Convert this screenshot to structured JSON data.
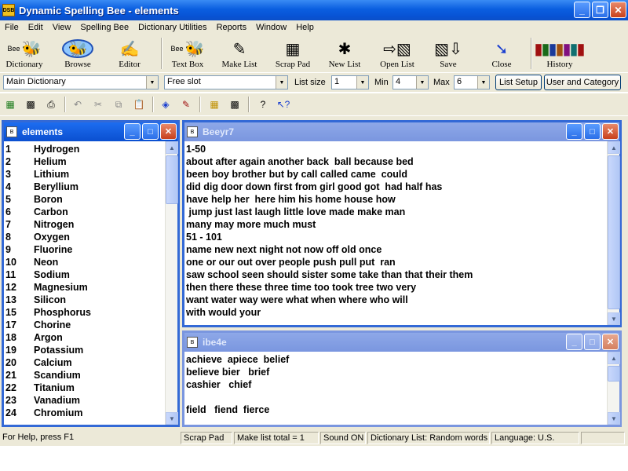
{
  "window": {
    "title": "Dynamic Spelling Bee - elements",
    "app_icon_text": "DSB"
  },
  "menu": [
    "File",
    "Edit",
    "View",
    "Spelling Bee",
    "Dictionary Utilities",
    "Reports",
    "Window",
    "Help"
  ],
  "toolbar": {
    "dictionary": "Dictionary",
    "dictionary_icon_text": "Bee",
    "browse": "Browse",
    "editor": "Editor",
    "textbox": "Text Box",
    "textbox_icon_text": "Bee",
    "makelist": "Make List",
    "scrappad": "Scrap Pad",
    "newlist": "New List",
    "openlist": "Open List",
    "save": "Save",
    "close": "Close",
    "history": "History"
  },
  "combos": {
    "dictionary_value": "Main Dictionary",
    "slot_value": "Free  slot",
    "list_size_label": "List size",
    "list_size_value": "1",
    "min_label": "Min",
    "min_value": "4",
    "max_label": "Max",
    "max_value": "6",
    "list_setup": "List Setup",
    "user_category": "User and Category"
  },
  "windows": {
    "elements": {
      "title": "elements",
      "rows": [
        {
          "n": "1",
          "name": "Hydrogen"
        },
        {
          "n": "2",
          "name": "Helium"
        },
        {
          "n": "3",
          "name": "Lithium"
        },
        {
          "n": "4",
          "name": "Beryllium"
        },
        {
          "n": "5",
          "name": "Boron"
        },
        {
          "n": "6",
          "name": "Carbon"
        },
        {
          "n": "7",
          "name": "Nitrogen"
        },
        {
          "n": "8",
          "name": "Oxygen"
        },
        {
          "n": "9",
          "name": "Fluorine"
        },
        {
          "n": "10",
          "name": "Neon"
        },
        {
          "n": "11",
          "name": "Sodium"
        },
        {
          "n": "12",
          "name": "Magnesium"
        },
        {
          "n": "13",
          "name": "Silicon"
        },
        {
          "n": "15",
          "name": "Phosphorus"
        },
        {
          "n": "17",
          "name": "Chorine"
        },
        {
          "n": "18",
          "name": "Argon"
        },
        {
          "n": "19",
          "name": "Potassium"
        },
        {
          "n": "20",
          "name": "Calcium"
        },
        {
          "n": "21",
          "name": "Scandium"
        },
        {
          "n": "22",
          "name": "Titanium"
        },
        {
          "n": "23",
          "name": "Vanadium"
        },
        {
          "n": "24",
          "name": "Chromium"
        }
      ]
    },
    "beeyr7": {
      "title": "Beeyr7",
      "lines": [
        "1-50",
        "about after again another back  ball because bed",
        "been boy brother but by call called came  could",
        "did dig door down first from girl good got  had half has",
        "have help her  here him his home house how",
        " jump just last laugh little love made make man",
        "many may more much must",
        "51 - 101",
        "name new next night not now off old once",
        "one or our out over people push pull put  ran",
        "saw school seen should sister some take than that their them",
        "then there these three time too took tree two very",
        "want water way were what when where who will",
        "with would your"
      ]
    },
    "ibe4e": {
      "title": "ibe4e",
      "lines": [
        "achieve  apiece  belief",
        "believe bier   brief",
        "cashier   chief",
        "",
        "field   fiend  fierce"
      ]
    }
  },
  "status": {
    "help": "For Help, press F1",
    "scrap": "Scrap Pad",
    "make_list": "Make list total = 1",
    "sound": "Sound ON",
    "dict_list": "Dictionary List: Random words",
    "language": "Language: U.S."
  }
}
